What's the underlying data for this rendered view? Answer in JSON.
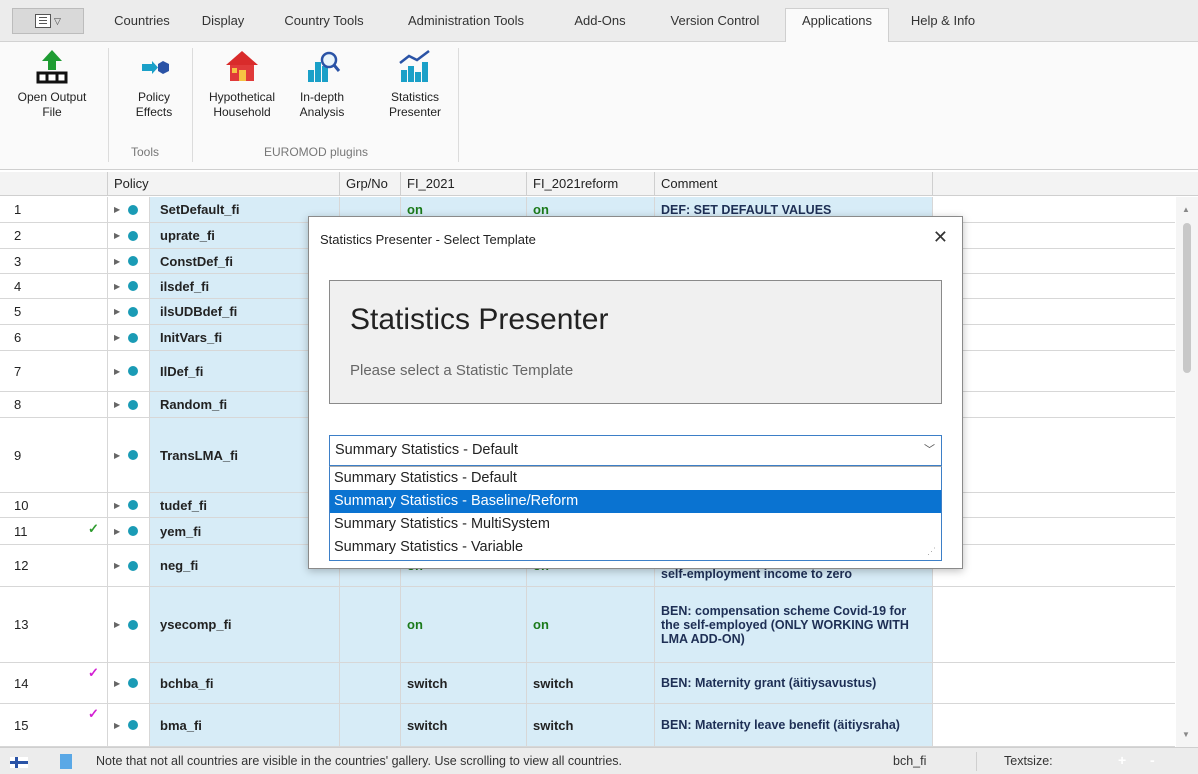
{
  "menu": {
    "tabs": [
      "Countries",
      "Display",
      "Country Tools",
      "Administration Tools",
      "Add-Ons",
      "Version Control",
      "Applications",
      "Help & Info"
    ],
    "active": "Applications"
  },
  "ribbon": {
    "open_output": "Open Output File",
    "policy_effects": "Policy Effects",
    "hypothetical_household": "Hypothetical Household",
    "in_depth": "In-depth Analysis",
    "statistics_presenter": "Statistics Presenter",
    "group_tools": "Tools",
    "group_plugins": "EUROMOD plugins"
  },
  "grid": {
    "headers": {
      "policy": "Policy",
      "grp": "Grp/No",
      "fi2021": "FI_2021",
      "fi2021r": "FI_2021reform",
      "comment": "Comment"
    },
    "rows": [
      {
        "num": "1",
        "name": "SetDefault_fi",
        "fi": "on",
        "fr": "on",
        "comment": "DEF: SET DEFAULT VALUES"
      },
      {
        "num": "2",
        "name": "uprate_fi",
        "fi": "",
        "fr": "",
        "comment": ""
      },
      {
        "num": "3",
        "name": "ConstDef_fi",
        "fi": "",
        "fr": "",
        "comment": ""
      },
      {
        "num": "4",
        "name": "ilsdef_fi",
        "fi": "",
        "fr": "",
        "comment": ""
      },
      {
        "num": "5",
        "name": "ilsUDBdef_fi",
        "fi": "",
        "fr": "",
        "comment": ""
      },
      {
        "num": "6",
        "name": "InitVars_fi",
        "fi": "",
        "fr": "",
        "comment": ""
      },
      {
        "num": "7",
        "name": "IlDef_fi",
        "fi": "",
        "fr": "",
        "comment": ""
      },
      {
        "num": "8",
        "name": "Random_fi",
        "fi": "",
        "fr": "",
        "comment": ""
      },
      {
        "num": "9",
        "name": "TransLMA_fi",
        "fi": "",
        "fr": "",
        "comment": ""
      },
      {
        "num": "10",
        "name": "tudef_fi",
        "fi": "",
        "fr": "",
        "comment": ""
      },
      {
        "num": "11",
        "name": "yem_fi",
        "fi": "",
        "fr": "",
        "comment": ""
      },
      {
        "num": "12",
        "name": "neg_fi",
        "fi": "on",
        "fr": "on",
        "comment": "self-employment income to zero"
      },
      {
        "num": "13",
        "name": "ysecomp_fi",
        "fi": "on",
        "fr": "on",
        "comment": "BEN: compensation scheme Covid-19 for the self-employed (ONLY WORKING WITH LMA ADD-ON)"
      },
      {
        "num": "14",
        "name": "bchba_fi",
        "fi": "switch",
        "fr": "switch",
        "comment": "BEN: Maternity grant (äitiysavustus)"
      },
      {
        "num": "15",
        "name": "bma_fi",
        "fi": "switch",
        "fr": "switch",
        "comment": "BEN: Maternity leave benefit (äitiysraha)"
      }
    ]
  },
  "status": {
    "note": "Note that not all countries are visible in the countries' gallery. Use scrolling to view all countries.",
    "system": "bch_fi",
    "textsize": "Textsize:",
    "plus": "+",
    "minus": "-"
  },
  "dialog": {
    "title": "Statistics Presenter - Select Template",
    "heading": "Statistics Presenter",
    "subheading": "Please select a Statistic Template",
    "selected": "Summary Statistics - Default",
    "options": [
      "Summary Statistics - Default",
      "Summary Statistics - Baseline/Reform",
      "Summary Statistics - MultiSystem",
      "Summary Statistics - Variable"
    ],
    "highlighted": "Summary Statistics - Baseline/Reform"
  },
  "colors": {
    "accent": "#0a73d1",
    "row_bg": "#d7ecf7",
    "on_green": "#1b7a1b",
    "check_green": "#2e9b2e",
    "check_magenta": "#d31fd3"
  }
}
